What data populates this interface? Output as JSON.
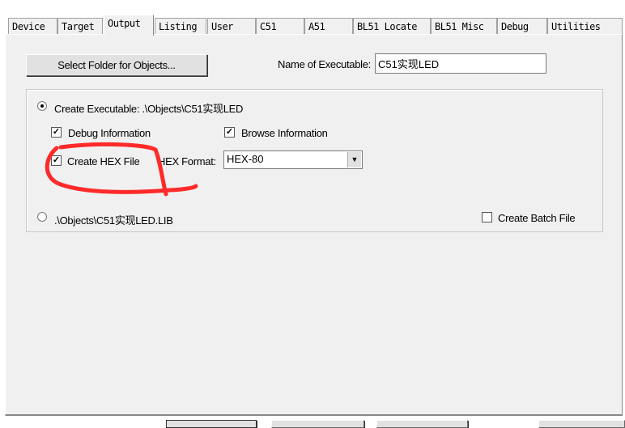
{
  "tabs": [
    {
      "label": "Device"
    },
    {
      "label": "Target"
    },
    {
      "label": "Output"
    },
    {
      "label": "Listing"
    },
    {
      "label": "User"
    },
    {
      "label": "C51"
    },
    {
      "label": "A51"
    },
    {
      "label": "BL51 Locate"
    },
    {
      "label": "BL51 Misc"
    },
    {
      "label": "Debug"
    },
    {
      "label": "Utilities"
    }
  ],
  "selected_tab": "Output",
  "output": {
    "select_folder_label": "Select Folder for Objects...",
    "name_exec_label": "Name of Executable:",
    "name_exec_value": "C51实现LED",
    "create_exec_label": "Create Executable:  .\\Objects\\C51实现LED",
    "create_exec_selected": true,
    "debug_info_label": "Debug Information",
    "debug_info_checked": true,
    "browse_info_label": "Browse Information",
    "browse_info_checked": true,
    "create_hex_label": "Create HEX File",
    "create_hex_checked": true,
    "hex_format_label": "HEX Format:",
    "hex_format_value": "HEX-80",
    "lib_label": ".\\Objects\\C51实现LED.LIB",
    "lib_selected": false,
    "batch_label": "Create Batch File",
    "batch_checked": false
  },
  "annotation_color": "#ff2a2a"
}
